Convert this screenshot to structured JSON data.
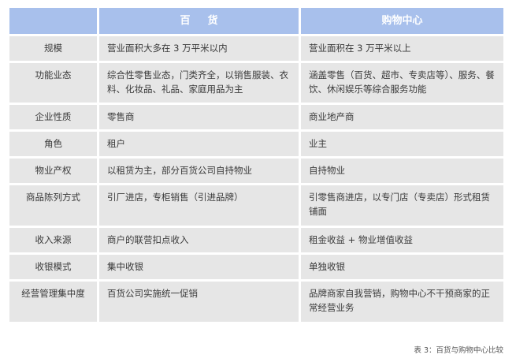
{
  "table": {
    "headers": [
      "",
      "百货",
      "购物中心"
    ],
    "rows": [
      [
        "规模",
        "营业面积大多在 3 万平米以内",
        "营业面积在 3 万平米以上"
      ],
      [
        "功能业态",
        "综合性零售业态，门类齐全，以销售服装、衣料、化妆品、礼品、家庭用品为主",
        "涵盖零售（百货、超市、专卖店等）、服务、餐饮、休闲娱乐等综合服务功能"
      ],
      [
        "企业性质",
        "零售商",
        "商业地产商"
      ],
      [
        "角色",
        "租户",
        "业主"
      ],
      [
        "物业产权",
        "以租赁为主，部分百货公司自持物业",
        "自持物业"
      ],
      [
        "商品陈列方式",
        "引厂进店，专柜销售（引进品牌）",
        "引零售商进店，以专门店（专卖店）形式租赁铺面"
      ],
      [
        "收入来源",
        "商户的联营扣点收入",
        "租金收益 + 物业增值收益"
      ],
      [
        "收银模式",
        "集中收银",
        "单独收银"
      ],
      [
        "经营管理集中度",
        "百货公司实施统一促销",
        "品牌商家自我营销，购物中心不干预商家的正常经营业务"
      ]
    ]
  },
  "caption": "表 3：百货与购物中心比较",
  "colors": {
    "header_bg": "#a8c0ec",
    "cell_bg": "#e6e6e6"
  }
}
